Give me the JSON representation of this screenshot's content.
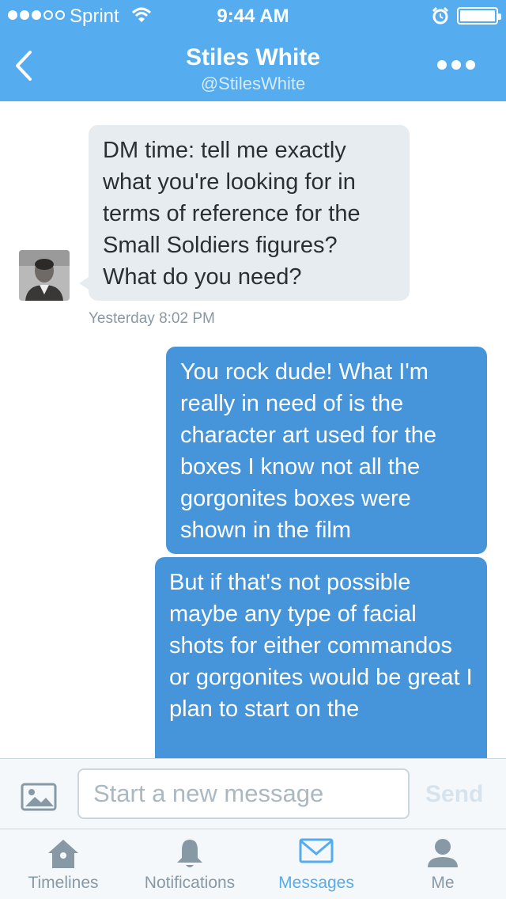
{
  "status_bar": {
    "carrier": "Sprint",
    "time": "9:44 AM",
    "signal_bars_filled": 3,
    "signal_bars_total": 5,
    "wifi_icon": "wifi-icon",
    "alarm_icon": "alarm-icon",
    "battery_level": 1.0
  },
  "header": {
    "title": "Stiles White",
    "subtitle": "@StilesWhite",
    "back_icon": "chevron-left-icon",
    "more_icon": "more-dots-icon"
  },
  "conversation": {
    "messages": [
      {
        "direction": "incoming",
        "text": "DM time: tell me exactly what you're looking for in terms of reference for the Small Soldiers figures? What do you need?"
      },
      {
        "direction": "outgoing",
        "text": "You rock dude! What I'm really in need of is the character art used for the boxes I know not all the gorgonites boxes were shown in the film"
      },
      {
        "direction": "outgoing",
        "text": "But if that's not possible maybe any type of facial shots for either commandos or gorgonites would be great I plan to start on the"
      }
    ],
    "timestamp": "Yesterday 8:02 PM"
  },
  "compose": {
    "placeholder": "Start a new message",
    "value": "",
    "send_label": "Send",
    "photo_icon": "photo-icon"
  },
  "tabbar": {
    "tabs": [
      {
        "label": "Timelines",
        "icon": "home-icon",
        "active": false
      },
      {
        "label": "Notifications",
        "icon": "bell-icon",
        "active": false
      },
      {
        "label": "Messages",
        "icon": "envelope-icon",
        "active": true
      },
      {
        "label": "Me",
        "icon": "person-icon",
        "active": false
      }
    ]
  },
  "colors": {
    "brand": "#55acee",
    "outgoing_bubble": "#4695da",
    "incoming_bubble": "#e6ecf0",
    "muted": "#8899a6"
  }
}
